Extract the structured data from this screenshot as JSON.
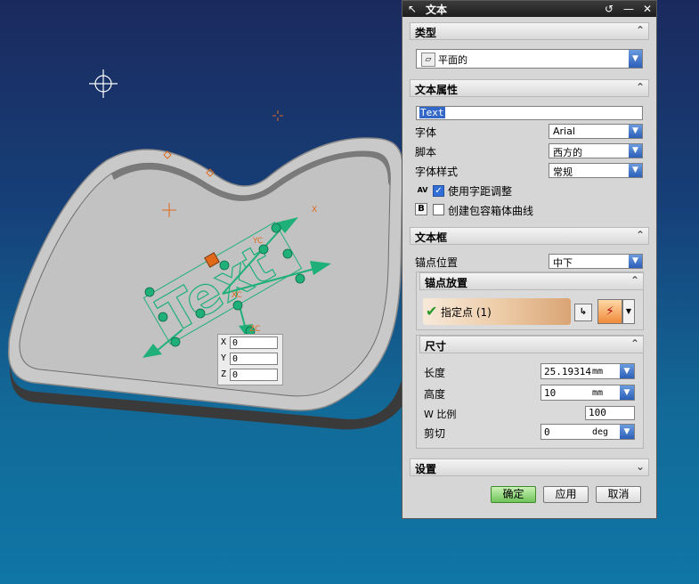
{
  "dialog": {
    "title": "文本",
    "sections": {
      "type": {
        "header": "类型",
        "value": "平面的"
      },
      "text_props": {
        "header": "文本属性",
        "text_value": "Text",
        "font_label": "字体",
        "font_value": "Arial",
        "script_label": "脚本",
        "script_value": "西方的",
        "style_label": "字体样式",
        "style_value": "常规",
        "kerning_label": "使用字距调整",
        "kerning_checked": true,
        "kerning_icon": "AV",
        "bbox_label": "创建包容箱体曲线",
        "bbox_checked": false,
        "bbox_icon": "B"
      },
      "text_box": {
        "header": "文本框",
        "anchor_label": "锚点位置",
        "anchor_value": "中下",
        "anchor_place_header": "锚点放置",
        "point_label": "指定点 (1)",
        "dims_header": "尺寸",
        "length_label": "长度",
        "length_value": "25.19314",
        "length_unit": "mm",
        "height_label": "高度",
        "height_value": "10",
        "height_unit": "mm",
        "wscale_label": "W 比例",
        "wscale_value": "100",
        "shear_label": "剪切",
        "shear_value": "0",
        "shear_unit": "deg"
      },
      "settings": {
        "header": "设置"
      }
    },
    "buttons": {
      "ok": "确定",
      "apply": "应用",
      "cancel": "取消"
    }
  },
  "viewport": {
    "coords": {
      "x_label": "X",
      "x_value": "0",
      "y_label": "Y",
      "y_value": "0",
      "z_label": "Z",
      "z_value": "0"
    },
    "text_preview": "Text",
    "axis_labels": {
      "yc": "YC",
      "xc": "XC",
      "zc": "ZC",
      "x": "X"
    }
  },
  "colors": {
    "accent_green": "#1fb07a",
    "handle_orange": "#e06a1a",
    "highlight_blue": "#3468c8"
  }
}
